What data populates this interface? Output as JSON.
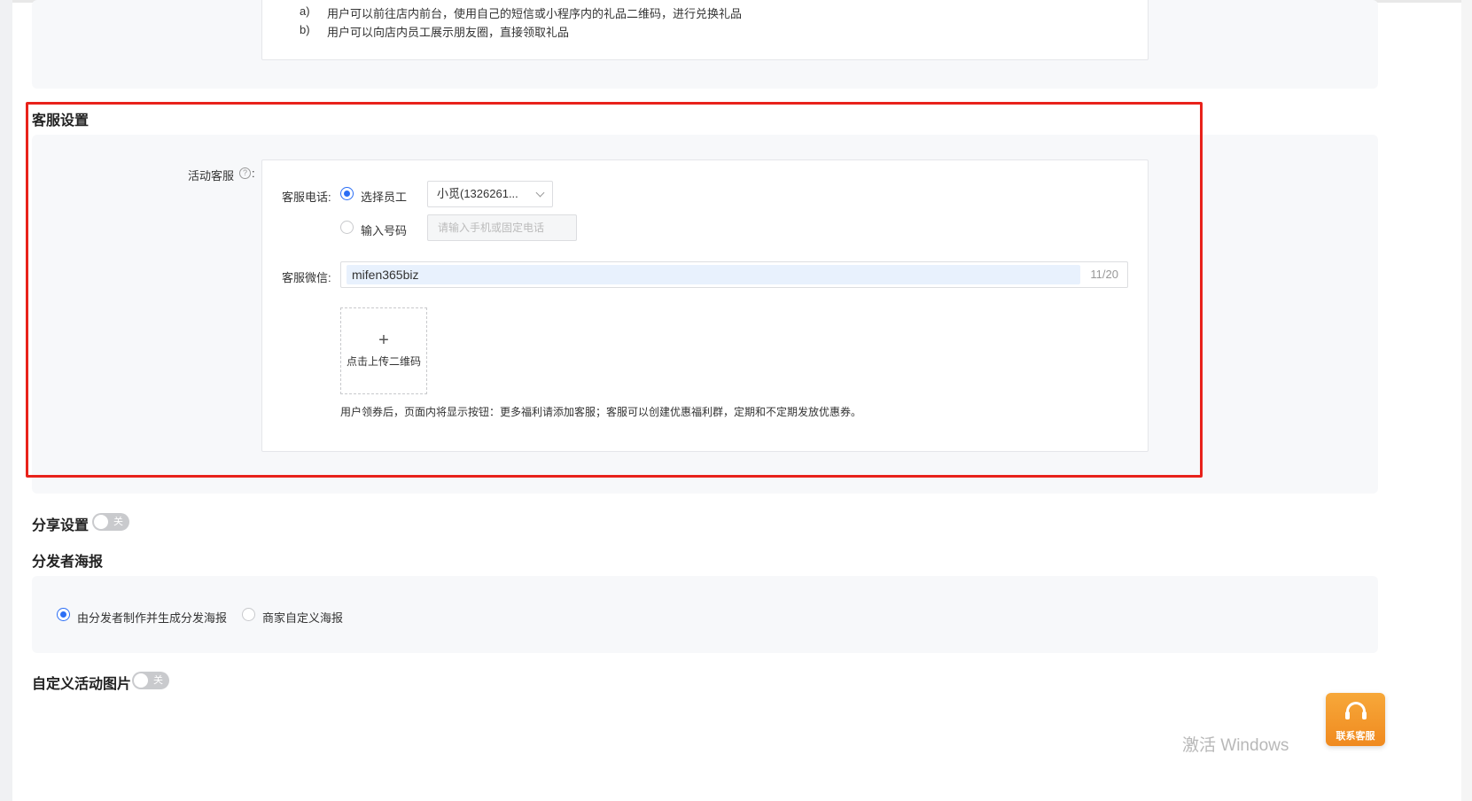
{
  "gift_redeem": {
    "items": [
      {
        "marker": "a)",
        "text": "用户可以前往店内前台，使用自己的短信或小程序内的礼品二维码，进行兑换礼品"
      },
      {
        "marker": "b)",
        "text": "用户可以向店内员工展示朋友圈，直接领取礼品"
      }
    ]
  },
  "customer_service": {
    "title": "客服设置",
    "activity_label": "活动客服",
    "help_symbol": "?",
    "colon": ":",
    "phone_label": "客服电话:",
    "option_select_employee": "选择员工",
    "employee_value": "小觅(1326261...",
    "option_input_number": "输入号码",
    "phone_placeholder": "请输入手机或固定电话",
    "phone_mode": "select_employee",
    "wechat_label": "客服微信:",
    "wechat_value": "mifen365biz",
    "wechat_counter": "11/20",
    "upload_plus": "+",
    "upload_label": "点击上传二维码",
    "hint": "用户领券后，页面内将显示按钮：更多福利请添加客服；客服可以创建优惠福利群，定期和不定期发放优惠券。"
  },
  "share_settings": {
    "title": "分享设置",
    "toggle_label": "关",
    "enabled": false
  },
  "distributor_poster": {
    "title": "分发者海报",
    "option_generated": "由分发者制作并生成分发海报",
    "option_custom": "商家自定义海报",
    "selected": "generated"
  },
  "custom_image": {
    "title": "自定义活动图片",
    "toggle_label": "关",
    "enabled": false
  },
  "float_contact": {
    "label": "联系客服",
    "icon": "headset-icon",
    "color": "#f59a2a"
  },
  "watermark": "激活 Windows",
  "colors": {
    "accent": "#2b6ef5",
    "highlight_frame": "#e8221b"
  }
}
